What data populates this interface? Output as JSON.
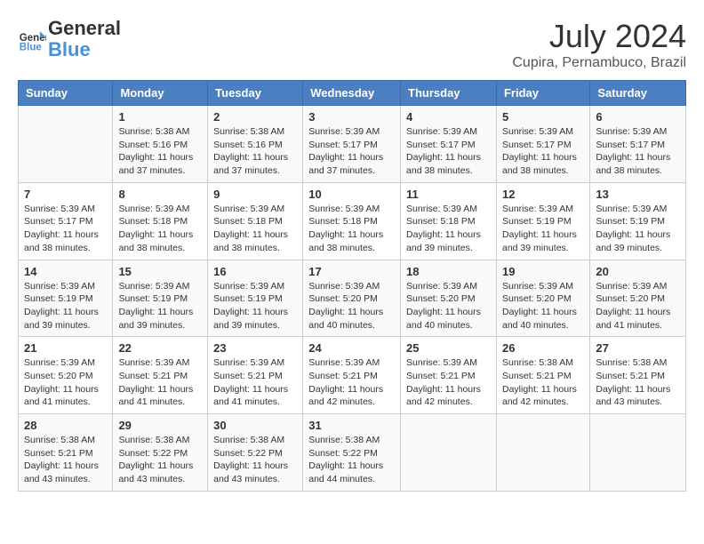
{
  "header": {
    "logo_line1": "General",
    "logo_line2": "Blue",
    "month_title": "July 2024",
    "location": "Cupira, Pernambuco, Brazil"
  },
  "days_of_week": [
    "Sunday",
    "Monday",
    "Tuesday",
    "Wednesday",
    "Thursday",
    "Friday",
    "Saturday"
  ],
  "weeks": [
    [
      {
        "day": "",
        "info": ""
      },
      {
        "day": "1",
        "info": "Sunrise: 5:38 AM\nSunset: 5:16 PM\nDaylight: 11 hours\nand 37 minutes."
      },
      {
        "day": "2",
        "info": "Sunrise: 5:38 AM\nSunset: 5:16 PM\nDaylight: 11 hours\nand 37 minutes."
      },
      {
        "day": "3",
        "info": "Sunrise: 5:39 AM\nSunset: 5:17 PM\nDaylight: 11 hours\nand 37 minutes."
      },
      {
        "day": "4",
        "info": "Sunrise: 5:39 AM\nSunset: 5:17 PM\nDaylight: 11 hours\nand 38 minutes."
      },
      {
        "day": "5",
        "info": "Sunrise: 5:39 AM\nSunset: 5:17 PM\nDaylight: 11 hours\nand 38 minutes."
      },
      {
        "day": "6",
        "info": "Sunrise: 5:39 AM\nSunset: 5:17 PM\nDaylight: 11 hours\nand 38 minutes."
      }
    ],
    [
      {
        "day": "7",
        "info": "Sunrise: 5:39 AM\nSunset: 5:17 PM\nDaylight: 11 hours\nand 38 minutes."
      },
      {
        "day": "8",
        "info": "Sunrise: 5:39 AM\nSunset: 5:18 PM\nDaylight: 11 hours\nand 38 minutes."
      },
      {
        "day": "9",
        "info": "Sunrise: 5:39 AM\nSunset: 5:18 PM\nDaylight: 11 hours\nand 38 minutes."
      },
      {
        "day": "10",
        "info": "Sunrise: 5:39 AM\nSunset: 5:18 PM\nDaylight: 11 hours\nand 38 minutes."
      },
      {
        "day": "11",
        "info": "Sunrise: 5:39 AM\nSunset: 5:18 PM\nDaylight: 11 hours\nand 39 minutes."
      },
      {
        "day": "12",
        "info": "Sunrise: 5:39 AM\nSunset: 5:19 PM\nDaylight: 11 hours\nand 39 minutes."
      },
      {
        "day": "13",
        "info": "Sunrise: 5:39 AM\nSunset: 5:19 PM\nDaylight: 11 hours\nand 39 minutes."
      }
    ],
    [
      {
        "day": "14",
        "info": "Sunrise: 5:39 AM\nSunset: 5:19 PM\nDaylight: 11 hours\nand 39 minutes."
      },
      {
        "day": "15",
        "info": "Sunrise: 5:39 AM\nSunset: 5:19 PM\nDaylight: 11 hours\nand 39 minutes."
      },
      {
        "day": "16",
        "info": "Sunrise: 5:39 AM\nSunset: 5:19 PM\nDaylight: 11 hours\nand 39 minutes."
      },
      {
        "day": "17",
        "info": "Sunrise: 5:39 AM\nSunset: 5:20 PM\nDaylight: 11 hours\nand 40 minutes."
      },
      {
        "day": "18",
        "info": "Sunrise: 5:39 AM\nSunset: 5:20 PM\nDaylight: 11 hours\nand 40 minutes."
      },
      {
        "day": "19",
        "info": "Sunrise: 5:39 AM\nSunset: 5:20 PM\nDaylight: 11 hours\nand 40 minutes."
      },
      {
        "day": "20",
        "info": "Sunrise: 5:39 AM\nSunset: 5:20 PM\nDaylight: 11 hours\nand 41 minutes."
      }
    ],
    [
      {
        "day": "21",
        "info": "Sunrise: 5:39 AM\nSunset: 5:20 PM\nDaylight: 11 hours\nand 41 minutes."
      },
      {
        "day": "22",
        "info": "Sunrise: 5:39 AM\nSunset: 5:21 PM\nDaylight: 11 hours\nand 41 minutes."
      },
      {
        "day": "23",
        "info": "Sunrise: 5:39 AM\nSunset: 5:21 PM\nDaylight: 11 hours\nand 41 minutes."
      },
      {
        "day": "24",
        "info": "Sunrise: 5:39 AM\nSunset: 5:21 PM\nDaylight: 11 hours\nand 42 minutes."
      },
      {
        "day": "25",
        "info": "Sunrise: 5:39 AM\nSunset: 5:21 PM\nDaylight: 11 hours\nand 42 minutes."
      },
      {
        "day": "26",
        "info": "Sunrise: 5:38 AM\nSunset: 5:21 PM\nDaylight: 11 hours\nand 42 minutes."
      },
      {
        "day": "27",
        "info": "Sunrise: 5:38 AM\nSunset: 5:21 PM\nDaylight: 11 hours\nand 43 minutes."
      }
    ],
    [
      {
        "day": "28",
        "info": "Sunrise: 5:38 AM\nSunset: 5:21 PM\nDaylight: 11 hours\nand 43 minutes."
      },
      {
        "day": "29",
        "info": "Sunrise: 5:38 AM\nSunset: 5:22 PM\nDaylight: 11 hours\nand 43 minutes."
      },
      {
        "day": "30",
        "info": "Sunrise: 5:38 AM\nSunset: 5:22 PM\nDaylight: 11 hours\nand 43 minutes."
      },
      {
        "day": "31",
        "info": "Sunrise: 5:38 AM\nSunset: 5:22 PM\nDaylight: 11 hours\nand 44 minutes."
      },
      {
        "day": "",
        "info": ""
      },
      {
        "day": "",
        "info": ""
      },
      {
        "day": "",
        "info": ""
      }
    ]
  ]
}
